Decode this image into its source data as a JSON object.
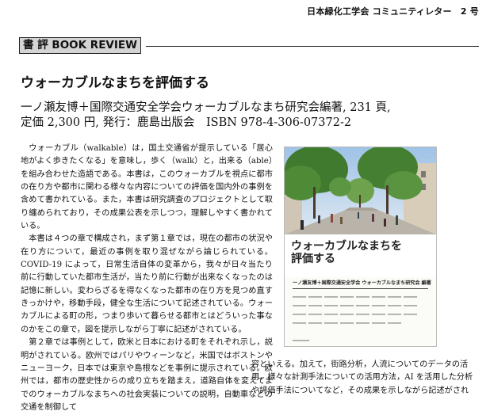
{
  "header": {
    "newsletter": "日本緑化工学会 コミュニティレター　2 号"
  },
  "section": {
    "label": "書 評 BOOK REVIEW"
  },
  "article": {
    "title": "ウォーカブルなまちを評価する",
    "meta_line1": "一ノ瀬友博＋国際交通安全学会ウォーカブルなまち研究会編著, 231 頁,",
    "meta_line2": "定価 2,300 円, 発行：鹿島出版会　ISBN 978-4-306-07372-2"
  },
  "body_left": {
    "paragraphs": [
      "ウォーカブル（walkable）は，国土交通省が提示している「居心地がよく歩きたくなる」を意味し，歩く（walk）と，出来る（able）を組み合わせた造語である。本書は，このウォーカブルを視点に都市の在り方や都市に関わる様々な内容についての評価を国内外の事例を含めて書かれている。また，本書は研究調査のプロジェクトとして取り纏められており，その成果公表を示しつつ，理解しやすく書かれている。",
      "本書は４つの章で構成され，まず第１章では，現在の都市の状況や在り方について，最近の事例を取り混ぜながら論じられている。COVID-19 によって，日常生活自体の変革から，我々が日々当たり前に行動していた都市生活が，当たり前に行動が出来なくなったのは記憶に新しい。変わらざるを得なくなった都市の在り方を見つめ直すきっかけや，移動手段，健全な生活について記述されている。ウォーカブルによる町の形，つまり歩いて暮らせる都市とはどういった事なのかをこの章で，図を提示しながら丁寧に記述がされている。",
      "第２章では事例として，欧米と日本における町をそれぞれ示し，説明がされている。欧州ではパリやウィーンなど，米国ではボストンやニューヨーク，日本では東京や島根などを事例に提示されている。欧州では，都市の歴史性からの成り立ちを踏まえ，道路自体を変えてまでのウォーカブルなまちへの社会実装についての説明，自動車などの交通を制御して"
    ]
  },
  "body_right": {
    "lines": [
      "容といえる。加えて，街路分析，人流についてのデータの活",
      "用，様々な計測手法についての活用方法，AI を活用した分析",
      "や評価手法についてなど，その成果を示しながら記述がされ"
    ]
  },
  "cover": {
    "title_line1": "ウォーカブルなまちを",
    "title_line2": "評価する",
    "authors": "一ノ瀬友博＋国際交通安全学会 ウォーカブルなまち研究会 編著"
  }
}
